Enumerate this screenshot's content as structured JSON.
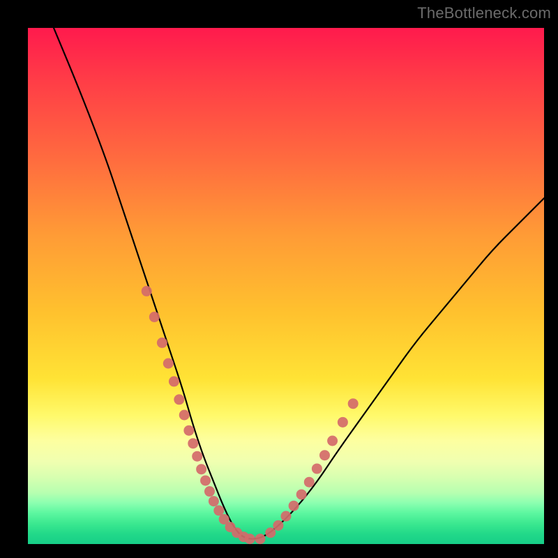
{
  "watermark": "TheBottleneck.com",
  "chart_data": {
    "type": "line",
    "title": "",
    "xlabel": "",
    "ylabel": "",
    "xlim": [
      0,
      100
    ],
    "ylim": [
      0,
      100
    ],
    "grid": false,
    "legend": false,
    "series": [
      {
        "name": "bottleneck-curve",
        "x": [
          5,
          10,
          15,
          18,
          21,
          24,
          27,
          30,
          32,
          34,
          36,
          38,
          40,
          42,
          45,
          48,
          52,
          56,
          60,
          65,
          70,
          75,
          80,
          85,
          90,
          95,
          100
        ],
        "values": [
          100,
          88,
          75,
          66,
          57,
          48,
          39,
          30,
          23,
          17,
          12,
          7,
          3,
          1,
          1,
          3,
          7,
          12,
          18,
          25,
          32,
          39,
          45,
          51,
          57,
          62,
          67
        ]
      }
    ],
    "markers": [
      {
        "name": "highlight-dots",
        "color": "#d46a6a",
        "x": [
          23,
          24.5,
          26,
          27.2,
          28.3,
          29.3,
          30.3,
          31.2,
          32,
          32.8,
          33.6,
          34.4,
          35.2,
          36,
          37,
          38,
          39.2,
          40.5,
          41.8,
          43,
          45,
          47,
          48.5,
          50,
          51.5,
          53,
          54.5,
          56,
          57.5,
          59,
          61,
          63
        ],
        "values": [
          49,
          44,
          39,
          35,
          31.5,
          28,
          25,
          22,
          19.5,
          17,
          14.5,
          12.3,
          10.2,
          8.3,
          6.5,
          4.8,
          3.3,
          2.2,
          1.4,
          1,
          1,
          2.2,
          3.6,
          5.4,
          7.4,
          9.6,
          12,
          14.6,
          17.2,
          20,
          23.6,
          27.2
        ]
      }
    ]
  }
}
